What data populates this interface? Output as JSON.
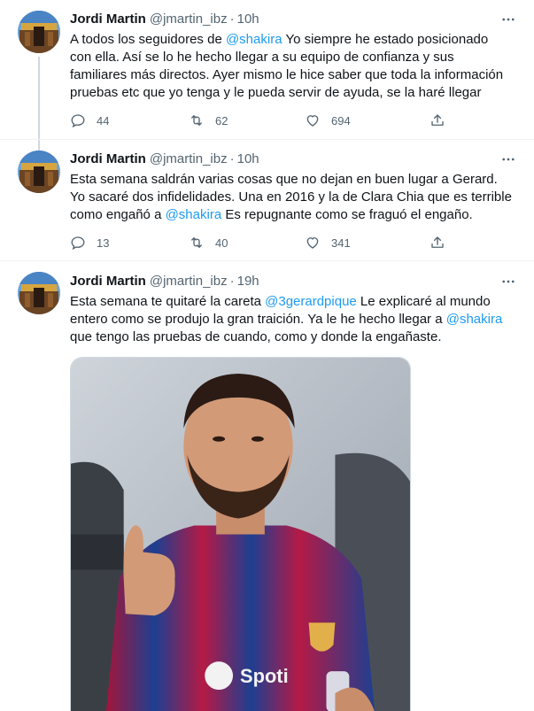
{
  "tweets": [
    {
      "author": {
        "name": "Jordi Martin",
        "handle": "@jmartin_ibz"
      },
      "separator": "·",
      "time": "10h",
      "text_parts": [
        {
          "t": "A todos los seguidores de ",
          "m": false
        },
        {
          "t": "@shakira",
          "m": true
        },
        {
          "t": " Yo siempre he estado posicionado con ella. Así se lo he hecho llegar a su equipo de confianza y sus familiares más directos. Ayer mismo le hice saber que toda la información pruebas etc que yo tenga y le pueda servir de ayuda, se la haré llegar",
          "m": false
        }
      ],
      "replies": "44",
      "retweets": "62",
      "likes": "694"
    },
    {
      "author": {
        "name": "Jordi Martin",
        "handle": "@jmartin_ibz"
      },
      "separator": "·",
      "time": "10h",
      "text_parts": [
        {
          "t": "Esta semana saldrán varias cosas que no dejan en buen lugar a Gerard. Yo sacaré dos infidelidades. Una en 2016 y la de Clara Chia que es terrible como engañó a ",
          "m": false
        },
        {
          "t": "@shakira",
          "m": true
        },
        {
          "t": " Es repugnante como se fraguó el engaño.",
          "m": false
        }
      ],
      "replies": "13",
      "retweets": "40",
      "likes": "341"
    },
    {
      "author": {
        "name": "Jordi Martin",
        "handle": "@jmartin_ibz"
      },
      "separator": "·",
      "time": "19h",
      "text_parts": [
        {
          "t": "Esta semana te quitaré la careta ",
          "m": false
        },
        {
          "t": "@3gerardpique",
          "m": true
        },
        {
          "t": " Le explicaré al mundo entero como se produjo la gran traición. Ya le he hecho llegar a ",
          "m": false
        },
        {
          "t": "@shakira",
          "m": true
        },
        {
          "t": " que tengo las pruebas de cuando, como y donde la engañaste.",
          "m": false
        }
      ]
    }
  ],
  "colors": {
    "text": "#0f1419",
    "secondary": "#536471",
    "mention": "#1d9bf0",
    "thread_line": "#cfd9de",
    "divider": "#eff3f4"
  },
  "icons": {
    "more": "more-horizontal-icon",
    "reply": "reply-icon",
    "retweet": "retweet-icon",
    "like": "heart-icon",
    "share": "share-icon"
  },
  "media": {
    "image": "photo-man-in-football-jersey-thumbs-up",
    "sponsor_text": "Spoti"
  }
}
